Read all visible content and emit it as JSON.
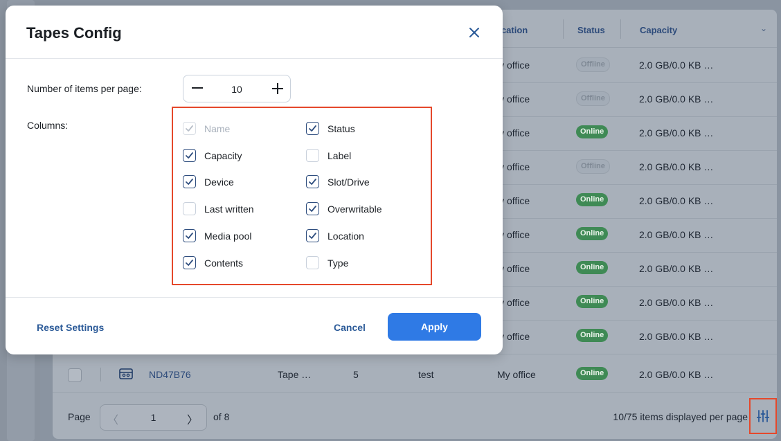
{
  "background_table": {
    "headers": {
      "location": "ocation",
      "status": "Status",
      "capacity": "Capacity"
    },
    "rows": [
      {
        "location": "ly office",
        "status": "Offline",
        "capacity": "2.0 GB/0.0 KB  …"
      },
      {
        "location": "ly office",
        "status": "Offline",
        "capacity": "2.0 GB/0.0 KB  …"
      },
      {
        "location": "ly office",
        "status": "Online",
        "capacity": "2.0 GB/0.0 KB  …"
      },
      {
        "location": "ly office",
        "status": "Offline",
        "capacity": "2.0 GB/0.0 KB  …"
      },
      {
        "location": "ly office",
        "status": "Online",
        "capacity": "2.0 GB/0.0 KB  …"
      },
      {
        "location": "ly office",
        "status": "Online",
        "capacity": "2.0 GB/0.0 KB  …"
      },
      {
        "location": "ly office",
        "status": "Online",
        "capacity": "2.0 GB/0.0 KB  …"
      },
      {
        "location": "ly office",
        "status": "Online",
        "capacity": "2.0 GB/0.0 KB  …"
      },
      {
        "location": "ly office",
        "status": "Online",
        "capacity": "2.0 GB/0.0 KB  …"
      }
    ],
    "last_row": {
      "name": "ND47B76",
      "device": "Tape …",
      "slot": "5",
      "media_pool": "test",
      "location": "My office",
      "status": "Online",
      "capacity": "2.0 GB/0.0 KB  …"
    }
  },
  "pagination": {
    "page_label": "Page",
    "current_page": "1",
    "of_label": "of 8",
    "items_label": "10/75 items displayed per page"
  },
  "modal": {
    "title": "Tapes Config",
    "items_per_page_label": "Number of items per page:",
    "items_per_page_value": "10",
    "columns_label": "Columns:",
    "columns_left": [
      {
        "label": "Name",
        "checked": true,
        "disabled": true
      },
      {
        "label": "Capacity",
        "checked": true,
        "disabled": false
      },
      {
        "label": "Device",
        "checked": true,
        "disabled": false
      },
      {
        "label": "Last written",
        "checked": false,
        "disabled": false
      },
      {
        "label": "Media pool",
        "checked": true,
        "disabled": false
      },
      {
        "label": "Contents",
        "checked": true,
        "disabled": false
      }
    ],
    "columns_right": [
      {
        "label": "Status",
        "checked": true,
        "disabled": false
      },
      {
        "label": "Label",
        "checked": false,
        "disabled": false
      },
      {
        "label": "Slot/Drive",
        "checked": true,
        "disabled": false
      },
      {
        "label": "Overwritable",
        "checked": true,
        "disabled": false
      },
      {
        "label": "Location",
        "checked": true,
        "disabled": false
      },
      {
        "label": "Type",
        "checked": false,
        "disabled": false
      }
    ],
    "reset_label": "Reset Settings",
    "cancel_label": "Cancel",
    "apply_label": "Apply"
  },
  "icons": {
    "close": "close-icon",
    "settings": "column-settings-icon",
    "tape": "tape-icon",
    "checkmark": "checkmark-icon"
  },
  "colors": {
    "accent": "#2f7ae5",
    "link": "#2b5a98",
    "highlight": "#e5482b",
    "online": "#3f8a55",
    "checkbox_border": "#2e4d7e"
  }
}
